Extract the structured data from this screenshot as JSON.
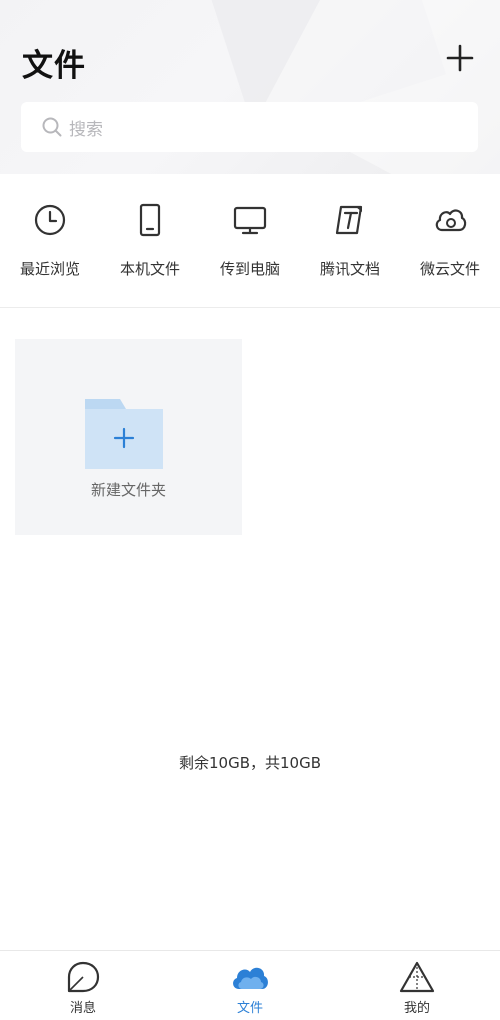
{
  "header": {
    "title": "文件",
    "add_icon": "plus-icon"
  },
  "search": {
    "placeholder": "搜索",
    "icon": "search-icon"
  },
  "shortcuts": [
    {
      "label": "最近浏览",
      "icon": "clock-icon"
    },
    {
      "label": "本机文件",
      "icon": "phone-icon"
    },
    {
      "label": "传到电脑",
      "icon": "monitor-icon"
    },
    {
      "label": "腾讯文档",
      "icon": "tencent-docs-icon"
    },
    {
      "label": "微云文件",
      "icon": "weiyun-cloud-icon"
    }
  ],
  "new_folder": {
    "label": "新建文件夹",
    "icon": "folder-plus-icon"
  },
  "storage": {
    "text": "剩余10GB，共10GB"
  },
  "tabbar": {
    "tabs": [
      {
        "label": "消息",
        "icon": "message-icon",
        "active": false
      },
      {
        "label": "文件",
        "icon": "cloud-icon",
        "active": true
      },
      {
        "label": "我的",
        "icon": "triangle-profile-icon",
        "active": false
      }
    ]
  },
  "colors": {
    "accent": "#2c80d6",
    "folder": "#cfe3f6",
    "folder_tab": "#bcd8f2",
    "icon_stroke": "#333333"
  }
}
